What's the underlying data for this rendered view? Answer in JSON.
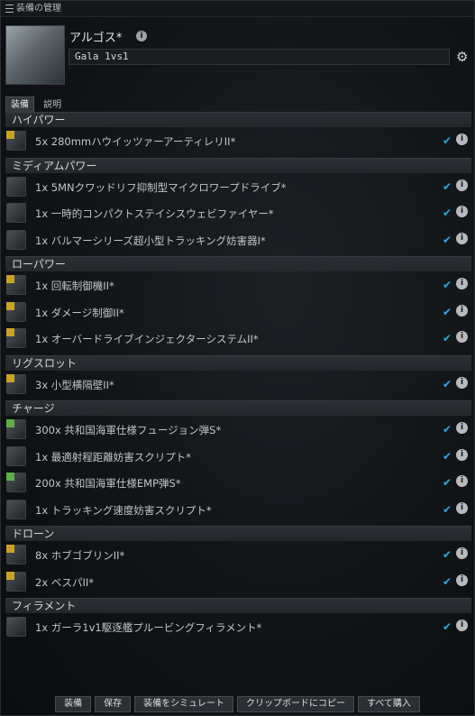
{
  "window": {
    "title": "装備の管理"
  },
  "header": {
    "ship_name": "アルゴス*",
    "fit_name": "Gala 1vs1"
  },
  "tabs": [
    {
      "label": "装備"
    },
    {
      "label": "説明"
    }
  ],
  "groups": [
    {
      "name": "ハイパワー",
      "items": [
        {
          "text": "5x 280mmハウイッツァーアーティレリII*",
          "icon": "artillery-icon",
          "tech": "II"
        }
      ]
    },
    {
      "name": "ミディアムパワー",
      "items": [
        {
          "text": "1x 5MNクワッドリフ抑制型マイクロワープドライブ*",
          "icon": "microwarpdrive-icon",
          "tech": ""
        },
        {
          "text": "1x 一時的コンパクトステイシスウェビファイヤー*",
          "icon": "stasis-webifier-icon",
          "tech": ""
        },
        {
          "text": "1x バルマーシリーズ超小型トラッキング妨害器I*",
          "icon": "tracking-disruptor-icon",
          "tech": ""
        }
      ]
    },
    {
      "name": "ローパワー",
      "items": [
        {
          "text": "1x 回転制御機II*",
          "icon": "gyrostabilizer-icon",
          "tech": "II"
        },
        {
          "text": "1x ダメージ制御II*",
          "icon": "damage-control-icon",
          "tech": "II"
        },
        {
          "text": "1x オーバードライブインジェクターシステムII*",
          "icon": "overdrive-injector-icon",
          "tech": "II"
        }
      ]
    },
    {
      "name": "リグスロット",
      "items": [
        {
          "text": "3x 小型横隔壁II*",
          "icon": "bulkhead-rig-icon",
          "tech": "II"
        }
      ]
    },
    {
      "name": "チャージ",
      "items": [
        {
          "text": "300x 共和国海軍仕様フュージョン弾S*",
          "icon": "fusion-ammo-icon",
          "tech": "N"
        },
        {
          "text": "1x 最適射程距離妨害スクリプト*",
          "icon": "script-icon",
          "tech": ""
        },
        {
          "text": "200x 共和国海軍仕様EMP弾S*",
          "icon": "emp-ammo-icon",
          "tech": "N"
        },
        {
          "text": "1x トラッキング速度妨害スクリプト*",
          "icon": "script-icon",
          "tech": ""
        }
      ]
    },
    {
      "name": "ドローン",
      "items": [
        {
          "text": "8x ホブゴブリンII*",
          "icon": "drone-icon",
          "tech": "II"
        },
        {
          "text": "2x ベスパII*",
          "icon": "drone-icon",
          "tech": "II"
        }
      ]
    },
    {
      "name": "フィラメント",
      "items": [
        {
          "text": "1x ガーラ1v1駆逐艦プルービングフィラメント*",
          "icon": "filament-icon",
          "tech": ""
        }
      ]
    }
  ],
  "buttons": [
    {
      "label": "装備"
    },
    {
      "label": "保存"
    },
    {
      "label": "装備をシミュレート"
    },
    {
      "label": "クリップボードにコピー"
    },
    {
      "label": "すべて購入"
    }
  ],
  "colors": {
    "check": "#2fa8e6",
    "tech2": "#c9a227",
    "navy": "#5fae4a"
  }
}
